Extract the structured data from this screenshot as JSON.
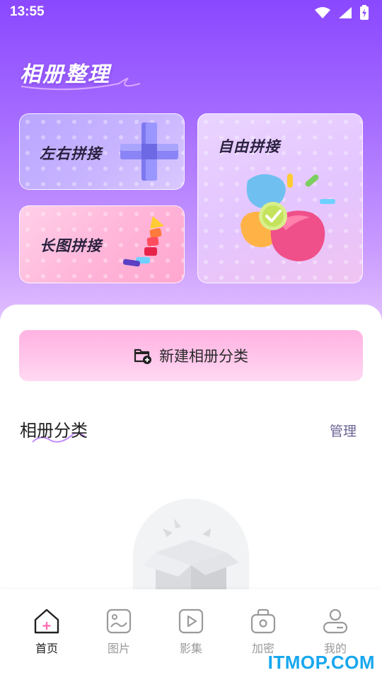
{
  "status_bar": {
    "time": "13:55"
  },
  "hero": {
    "title": "相册整理"
  },
  "cards": {
    "left_right": "左右拼接",
    "long_image": "长图拼接",
    "free": "自由拼接"
  },
  "new_album_button": {
    "label": "新建相册分类"
  },
  "section": {
    "title": "相册分类",
    "manage_label": "管理"
  },
  "tabs": [
    {
      "label": "首页",
      "icon": "home-icon",
      "active": true
    },
    {
      "label": "图片",
      "icon": "image-icon",
      "active": false
    },
    {
      "label": "影集",
      "icon": "video-icon",
      "active": false
    },
    {
      "label": "加密",
      "icon": "lock-bag-icon",
      "active": false
    },
    {
      "label": "我的",
      "icon": "user-icon",
      "active": false
    }
  ],
  "watermark": "ITMOP.COM",
  "colors": {
    "hero_top": "#8a48ff",
    "hero_bottom": "#e6c6ff",
    "accent_pink": "#ff6fb5",
    "watermark": "#18a7ee"
  }
}
